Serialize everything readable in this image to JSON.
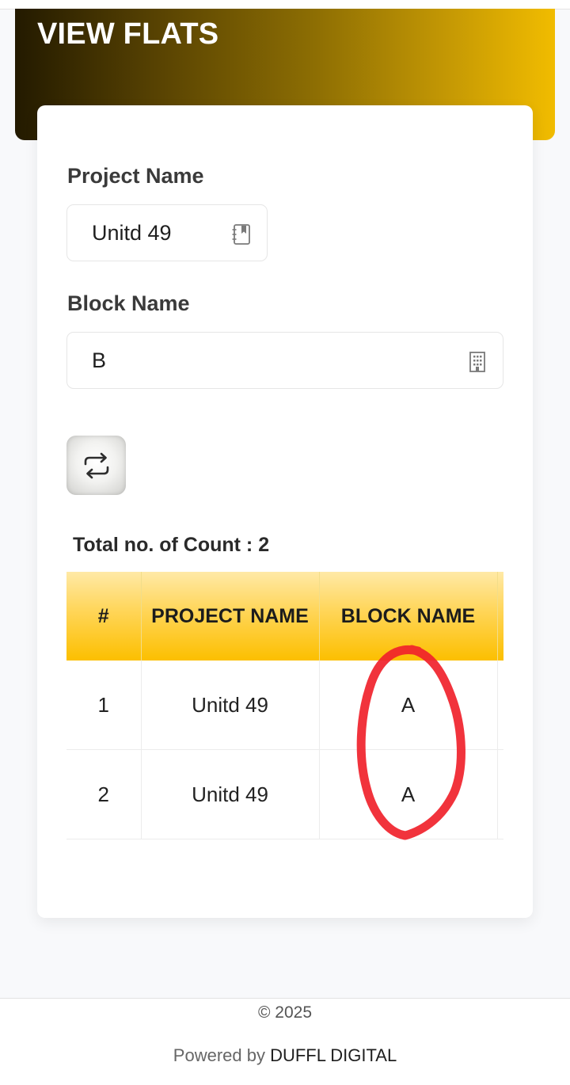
{
  "header": {
    "title": "VIEW FLATS"
  },
  "form": {
    "project_name_label": "Project Name",
    "project_name_value": "Unitd 49",
    "project_icon": "notebook-icon",
    "block_name_label": "Block Name",
    "block_name_value": "B",
    "block_icon": "building-icon",
    "refresh_icon": "repeat-icon"
  },
  "summary": {
    "count_text": "Total no. of Count : 2"
  },
  "table": {
    "headers": [
      "#",
      "PROJECT NAME",
      "BLOCK NAME"
    ],
    "rows": [
      {
        "index": "1",
        "project": "Unitd 49",
        "block": "A"
      },
      {
        "index": "2",
        "project": "Unitd 49",
        "block": "A"
      }
    ]
  },
  "footer": {
    "copyright": "© 2025",
    "powered_prefix": "Powered by",
    "powered_brand": "DUFFL DIGITAL"
  },
  "colors": {
    "header_gradient_start": "#231a00",
    "header_gradient_end": "#f1bc00",
    "table_header_yellow": "#fcbf00",
    "annotation_red": "#f0222b"
  }
}
